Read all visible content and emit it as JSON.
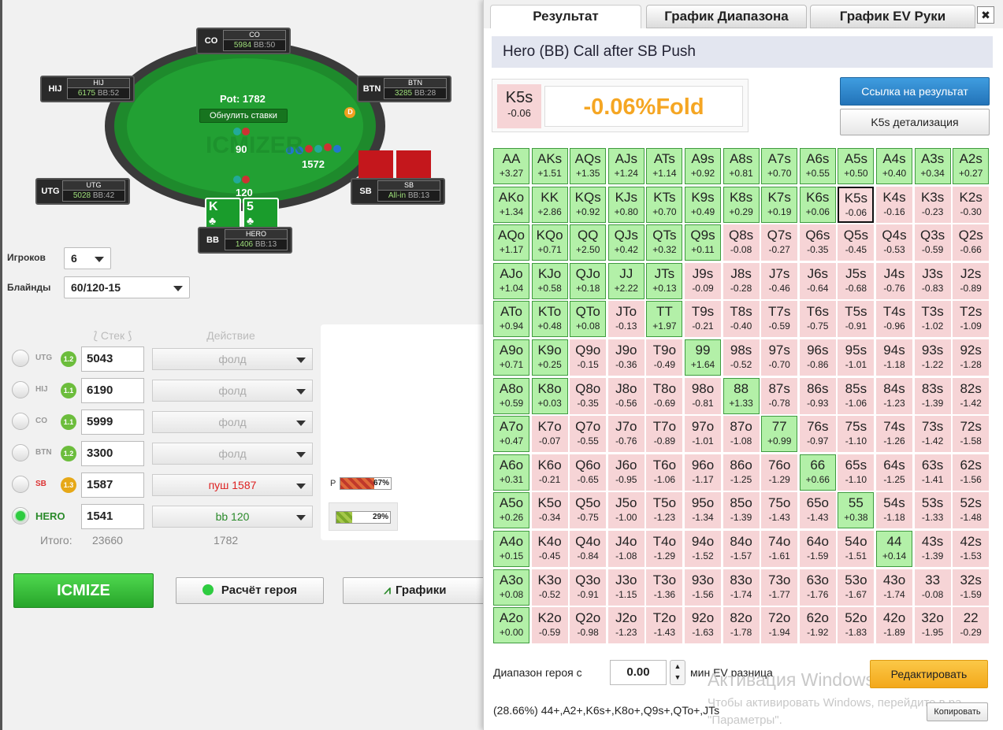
{
  "table": {
    "pot": "Pot: 1782",
    "reset_label": "Обнулить ставки",
    "watermark": "ICMIZER",
    "bet_hij_sb": "90",
    "bet_btn": "1572",
    "bet_bb": "120",
    "dealer": "D",
    "hero_cards": [
      "K",
      "5"
    ],
    "seats": [
      {
        "pos": "CO",
        "name": "CO",
        "stack": "5984",
        "bb": "BB:50"
      },
      {
        "pos": "HIJ",
        "name": "HIJ",
        "stack": "6175",
        "bb": "BB:52"
      },
      {
        "pos": "BTN",
        "name": "BTN",
        "stack": "3285",
        "bb": "BB:28"
      },
      {
        "pos": "UTG",
        "name": "UTG",
        "stack": "5028",
        "bb": "BB:42"
      },
      {
        "pos": "SB",
        "name": "SB",
        "stack": "All-in",
        "bb": "BB:13"
      },
      {
        "pos": "BB",
        "name": "HERO",
        "stack": "1406",
        "bb": "BB:13"
      }
    ]
  },
  "controls": {
    "players_label": "Игроков",
    "players_value": "6",
    "blinds_label": "Блайнды",
    "blinds_value": "60/120-15",
    "col_stack": "Стек",
    "col_action": "Действие",
    "rows": [
      {
        "pos": "UTG",
        "badge": "1.2",
        "stack": "5043",
        "action": "фолд"
      },
      {
        "pos": "HIJ",
        "badge": "1.1",
        "stack": "6190",
        "action": "фолд"
      },
      {
        "pos": "CO",
        "badge": "1.1",
        "stack": "5999",
        "action": "фолд"
      },
      {
        "pos": "BTN",
        "badge": "1.2",
        "stack": "3300",
        "action": "фолд"
      },
      {
        "pos": "SB",
        "badge": "1.3",
        "stack": "1587",
        "action": "пуш 1587"
      },
      {
        "pos": "HERO",
        "badge": "",
        "stack": "1541",
        "action": "bb 120"
      }
    ],
    "total_label": "Итого:",
    "total_stack": "23660",
    "total_pot": "1782",
    "range_p_label": "P",
    "range_p_pct": "67%",
    "range_h_pct": "29%",
    "icmize": "ICMIZE",
    "hero_calc": "Расчёт героя",
    "charts": "Графики"
  },
  "panel": {
    "tabs": [
      "Результат",
      "График Диапазона",
      "График EV Руки"
    ],
    "close": "✖",
    "header": "Hero (BB) Call after SB Push",
    "hand": "K5s",
    "hand_ev": "-0.06",
    "result": "-0.06%Fold",
    "link_btn": "Ссылка на результат",
    "detail_btn": "K5s детализация",
    "range_label": "Диапазон героя с",
    "min_ev": "0.00",
    "min_ev_label": "мин EV разница",
    "edit_btn": "Редактировать",
    "range_text": "(28.66%) 44+,A2+,K6s+,K8o+,Q9s+,QTo+,JTs",
    "copy_btn": "Копировать",
    "win_title": "Активация Windows",
    "win_sub": "Чтобы активировать Windows, перейдите в ра",
    "win_sub2": "\"Параметры\".",
    "colors": {
      "positive": "#b3f0a8",
      "negative": "#f6d4d6",
      "accent": "#2f86c8",
      "warning": "#f7b731"
    }
  },
  "grid": [
    [
      [
        "AA",
        "+3.27"
      ],
      [
        "AKs",
        "+1.51"
      ],
      [
        "AQs",
        "+1.35"
      ],
      [
        "AJs",
        "+1.24"
      ],
      [
        "ATs",
        "+1.14"
      ],
      [
        "A9s",
        "+0.92"
      ],
      [
        "A8s",
        "+0.81"
      ],
      [
        "A7s",
        "+0.70"
      ],
      [
        "A6s",
        "+0.55"
      ],
      [
        "A5s",
        "+0.50"
      ],
      [
        "A4s",
        "+0.40"
      ],
      [
        "A3s",
        "+0.34"
      ],
      [
        "A2s",
        "+0.27"
      ]
    ],
    [
      [
        "AKo",
        "+1.34"
      ],
      [
        "KK",
        "+2.86"
      ],
      [
        "KQs",
        "+0.92"
      ],
      [
        "KJs",
        "+0.80"
      ],
      [
        "KTs",
        "+0.70"
      ],
      [
        "K9s",
        "+0.49"
      ],
      [
        "K8s",
        "+0.29"
      ],
      [
        "K7s",
        "+0.19"
      ],
      [
        "K6s",
        "+0.06"
      ],
      [
        "K5s",
        "-0.06"
      ],
      [
        "K4s",
        "-0.16"
      ],
      [
        "K3s",
        "-0.23"
      ],
      [
        "K2s",
        "-0.30"
      ]
    ],
    [
      [
        "AQo",
        "+1.17"
      ],
      [
        "KQo",
        "+0.71"
      ],
      [
        "QQ",
        "+2.50"
      ],
      [
        "QJs",
        "+0.42"
      ],
      [
        "QTs",
        "+0.32"
      ],
      [
        "Q9s",
        "+0.11"
      ],
      [
        "Q8s",
        "-0.08"
      ],
      [
        "Q7s",
        "-0.27"
      ],
      [
        "Q6s",
        "-0.35"
      ],
      [
        "Q5s",
        "-0.45"
      ],
      [
        "Q4s",
        "-0.53"
      ],
      [
        "Q3s",
        "-0.59"
      ],
      [
        "Q2s",
        "-0.66"
      ]
    ],
    [
      [
        "AJo",
        "+1.04"
      ],
      [
        "KJo",
        "+0.58"
      ],
      [
        "QJo",
        "+0.18"
      ],
      [
        "JJ",
        "+2.22"
      ],
      [
        "JTs",
        "+0.13"
      ],
      [
        "J9s",
        "-0.09"
      ],
      [
        "J8s",
        "-0.28"
      ],
      [
        "J7s",
        "-0.46"
      ],
      [
        "J6s",
        "-0.64"
      ],
      [
        "J5s",
        "-0.68"
      ],
      [
        "J4s",
        "-0.76"
      ],
      [
        "J3s",
        "-0.83"
      ],
      [
        "J2s",
        "-0.89"
      ]
    ],
    [
      [
        "ATo",
        "+0.94"
      ],
      [
        "KTo",
        "+0.48"
      ],
      [
        "QTo",
        "+0.08"
      ],
      [
        "JTo",
        "-0.13"
      ],
      [
        "TT",
        "+1.97"
      ],
      [
        "T9s",
        "-0.21"
      ],
      [
        "T8s",
        "-0.40"
      ],
      [
        "T7s",
        "-0.59"
      ],
      [
        "T6s",
        "-0.75"
      ],
      [
        "T5s",
        "-0.91"
      ],
      [
        "T4s",
        "-0.96"
      ],
      [
        "T3s",
        "-1.02"
      ],
      [
        "T2s",
        "-1.09"
      ]
    ],
    [
      [
        "A9o",
        "+0.71"
      ],
      [
        "K9o",
        "+0.25"
      ],
      [
        "Q9o",
        "-0.15"
      ],
      [
        "J9o",
        "-0.36"
      ],
      [
        "T9o",
        "-0.49"
      ],
      [
        "99",
        "+1.64"
      ],
      [
        "98s",
        "-0.52"
      ],
      [
        "97s",
        "-0.70"
      ],
      [
        "96s",
        "-0.86"
      ],
      [
        "95s",
        "-1.01"
      ],
      [
        "94s",
        "-1.18"
      ],
      [
        "93s",
        "-1.22"
      ],
      [
        "92s",
        "-1.28"
      ]
    ],
    [
      [
        "A8o",
        "+0.59"
      ],
      [
        "K8o",
        "+0.03"
      ],
      [
        "Q8o",
        "-0.35"
      ],
      [
        "J8o",
        "-0.56"
      ],
      [
        "T8o",
        "-0.69"
      ],
      [
        "98o",
        "-0.81"
      ],
      [
        "88",
        "+1.33"
      ],
      [
        "87s",
        "-0.78"
      ],
      [
        "86s",
        "-0.93"
      ],
      [
        "85s",
        "-1.06"
      ],
      [
        "84s",
        "-1.23"
      ],
      [
        "83s",
        "-1.39"
      ],
      [
        "82s",
        "-1.42"
      ]
    ],
    [
      [
        "A7o",
        "+0.47"
      ],
      [
        "K7o",
        "-0.07"
      ],
      [
        "Q7o",
        "-0.55"
      ],
      [
        "J7o",
        "-0.76"
      ],
      [
        "T7o",
        "-0.89"
      ],
      [
        "97o",
        "-1.01"
      ],
      [
        "87o",
        "-1.08"
      ],
      [
        "77",
        "+0.99"
      ],
      [
        "76s",
        "-0.97"
      ],
      [
        "75s",
        "-1.10"
      ],
      [
        "74s",
        "-1.26"
      ],
      [
        "73s",
        "-1.42"
      ],
      [
        "72s",
        "-1.58"
      ]
    ],
    [
      [
        "A6o",
        "+0.31"
      ],
      [
        "K6o",
        "-0.21"
      ],
      [
        "Q6o",
        "-0.65"
      ],
      [
        "J6o",
        "-0.95"
      ],
      [
        "T6o",
        "-1.06"
      ],
      [
        "96o",
        "-1.17"
      ],
      [
        "86o",
        "-1.25"
      ],
      [
        "76o",
        "-1.29"
      ],
      [
        "66",
        "+0.66"
      ],
      [
        "65s",
        "-1.10"
      ],
      [
        "64s",
        "-1.25"
      ],
      [
        "63s",
        "-1.41"
      ],
      [
        "62s",
        "-1.56"
      ]
    ],
    [
      [
        "A5o",
        "+0.26"
      ],
      [
        "K5o",
        "-0.34"
      ],
      [
        "Q5o",
        "-0.75"
      ],
      [
        "J5o",
        "-1.00"
      ],
      [
        "T5o",
        "-1.23"
      ],
      [
        "95o",
        "-1.34"
      ],
      [
        "85o",
        "-1.39"
      ],
      [
        "75o",
        "-1.43"
      ],
      [
        "65o",
        "-1.43"
      ],
      [
        "55",
        "+0.38"
      ],
      [
        "54s",
        "-1.18"
      ],
      [
        "53s",
        "-1.33"
      ],
      [
        "52s",
        "-1.48"
      ]
    ],
    [
      [
        "A4o",
        "+0.15"
      ],
      [
        "K4o",
        "-0.45"
      ],
      [
        "Q4o",
        "-0.84"
      ],
      [
        "J4o",
        "-1.08"
      ],
      [
        "T4o",
        "-1.29"
      ],
      [
        "94o",
        "-1.52"
      ],
      [
        "84o",
        "-1.57"
      ],
      [
        "74o",
        "-1.61"
      ],
      [
        "64o",
        "-1.59"
      ],
      [
        "54o",
        "-1.51"
      ],
      [
        "44",
        "+0.14"
      ],
      [
        "43s",
        "-1.39"
      ],
      [
        "42s",
        "-1.53"
      ]
    ],
    [
      [
        "A3o",
        "+0.08"
      ],
      [
        "K3o",
        "-0.52"
      ],
      [
        "Q3o",
        "-0.91"
      ],
      [
        "J3o",
        "-1.15"
      ],
      [
        "T3o",
        "-1.36"
      ],
      [
        "93o",
        "-1.56"
      ],
      [
        "83o",
        "-1.74"
      ],
      [
        "73o",
        "-1.77"
      ],
      [
        "63o",
        "-1.76"
      ],
      [
        "53o",
        "-1.67"
      ],
      [
        "43o",
        "-1.74"
      ],
      [
        "33",
        "-0.08"
      ],
      [
        "32s",
        "-1.59"
      ]
    ],
    [
      [
        "A2o",
        "+0.00"
      ],
      [
        "K2o",
        "-0.59"
      ],
      [
        "Q2o",
        "-0.98"
      ],
      [
        "J2o",
        "-1.23"
      ],
      [
        "T2o",
        "-1.43"
      ],
      [
        "92o",
        "-1.63"
      ],
      [
        "82o",
        "-1.78"
      ],
      [
        "72o",
        "-1.94"
      ],
      [
        "62o",
        "-1.92"
      ],
      [
        "52o",
        "-1.83"
      ],
      [
        "42o",
        "-1.89"
      ],
      [
        "32o",
        "-1.95"
      ],
      [
        "22",
        "-0.29"
      ]
    ]
  ]
}
